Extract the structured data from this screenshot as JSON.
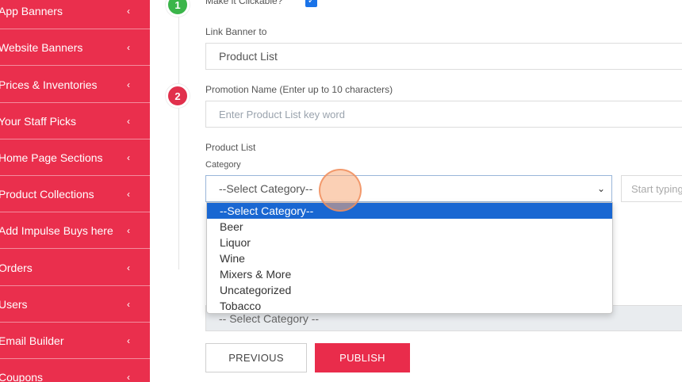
{
  "sidebar": {
    "items": [
      {
        "label": "App Banners"
      },
      {
        "label": "Website Banners"
      },
      {
        "label": "Prices & Inventories"
      },
      {
        "label": "Your Staff Picks"
      },
      {
        "label": "Home Page Sections"
      },
      {
        "label": "Product Collections"
      },
      {
        "label": "Add Impulse Buys here"
      },
      {
        "label": "Orders"
      },
      {
        "label": "Users"
      },
      {
        "label": "Email Builder"
      },
      {
        "label": "Coupons"
      }
    ],
    "chevron": "‹"
  },
  "steps": {
    "step1": "1",
    "step2": "2"
  },
  "form": {
    "clickable_label": "Make it Clickable?",
    "clickable_checked": true,
    "check_glyph": "✓",
    "link_banner_label": "Link Banner to",
    "link_banner_value": "Product List",
    "promotion_label": "Promotion Name (Enter up to 10 characters)",
    "promotion_placeholder": "Enter Product List key word",
    "product_list_label": "Product List",
    "category_label": "Category",
    "category_selected": "--Select Category--",
    "category_arrow": "⌄",
    "category_options": [
      "--Select Category--",
      "Beer",
      "Liquor",
      "Wine",
      "Mixers & More",
      "Uncategorized",
      "Tobacco"
    ],
    "search_placeholder": "Start typing",
    "category_bar": "-- Select Category --"
  },
  "buttons": {
    "previous": "PREVIOUS",
    "publish": "PUBLISH"
  },
  "colors": {
    "sidebar": "#ea2f4d",
    "publish": "#e92c4b",
    "highlight": "#1967d2",
    "step1": "#3bb54a",
    "step2": "#e1304c"
  }
}
